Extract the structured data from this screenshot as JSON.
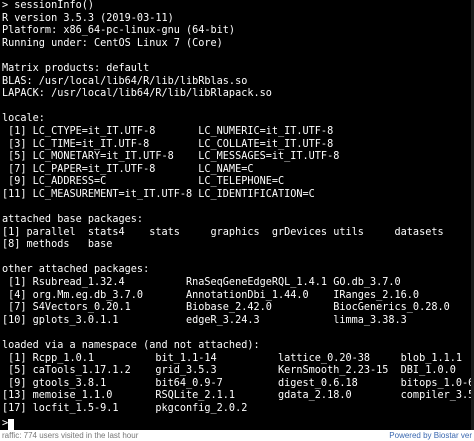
{
  "terminal": {
    "lines": [
      "> sessionInfo()",
      "R version 3.5.3 (2019-03-11)",
      "Platform: x86_64-pc-linux-gnu (64-bit)",
      "Running under: CentOS Linux 7 (Core)",
      "",
      "Matrix products: default",
      "BLAS: /usr/local/lib64/R/lib/libRblas.so",
      "LAPACK: /usr/local/lib64/R/lib/libRlapack.so",
      "",
      "locale:",
      " [1] LC_CTYPE=it_IT.UTF-8       LC_NUMERIC=it_IT.UTF-8",
      " [3] LC_TIME=it_IT.UTF-8        LC_COLLATE=it_IT.UTF-8",
      " [5] LC_MONETARY=it_IT.UTF-8    LC_MESSAGES=it_IT.UTF-8",
      " [7] LC_PAPER=it_IT.UTF-8       LC_NAME=C",
      " [9] LC_ADDRESS=C               LC_TELEPHONE=C",
      "[11] LC_MEASUREMENT=it_IT.UTF-8 LC_IDENTIFICATION=C",
      "",
      "attached base packages:",
      "[1] parallel  stats4    stats     graphics  grDevices utils     datasets",
      "[8] methods   base",
      "",
      "other attached packages:",
      " [1] Rsubread_1.32.4          RnaSeqGeneEdgeRQL_1.4.1 GO.db_3.7.0",
      " [4] org.Mm.eg.db_3.7.0       AnnotationDbi_1.44.0    IRanges_2.16.0",
      " [7] S4Vectors_0.20.1         Biobase_2.42.0          BiocGenerics_0.28.0",
      "[10] gplots_3.0.1.1           edgeR_3.24.3            limma_3.38.3",
      "",
      "loaded via a namespace (and not attached):",
      " [1] Rcpp_1.0.1          bit_1.1-14          lattice_0.20-38     blob_1.1.1",
      " [5] caTools_1.17.1.2    grid_3.5.3          KernSmooth_2.23-15  DBI_1.0.0",
      " [9] gtools_3.8.1        bit64_0.9-7         digest_0.6.18       bitops_1.0-6",
      "[13] memoise_1.1.0       RSQLite_2.1.1       gdata_2.18.0        compiler_3.5.3",
      "[17] locfit_1.5-9.1      pkgconfig_2.0.2"
    ],
    "prompt_symbol": ">"
  },
  "footer": {
    "left_text": "raffic: 774 users visited in the last hour",
    "right_text": "Powered by Biostar ver"
  }
}
